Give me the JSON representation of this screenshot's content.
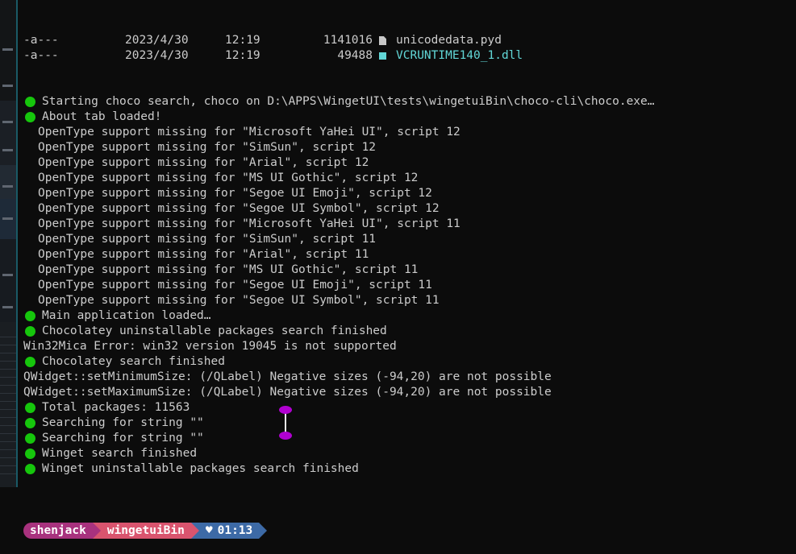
{
  "listing": [
    {
      "perm": "-a---",
      "date": "2023/4/30",
      "time": "12:19",
      "size": "1141016",
      "icon": "file-icon",
      "name": "unicodedata.pyd",
      "highlight": false
    },
    {
      "perm": "-a---",
      "date": "2023/4/30",
      "time": "12:19",
      "size": "49488",
      "icon": "dll-file-icon",
      "name": "VCRUNTIME140_1.dll",
      "highlight": true
    }
  ],
  "log": [
    {
      "dot": true,
      "text": "Starting choco search, choco on D:\\APPS\\WingetUI\\tests\\wingetuiBin\\choco-cli\\choco.exe…"
    },
    {
      "dot": true,
      "text": "About tab loaded!"
    },
    {
      "dot": false,
      "indent": true,
      "text": "OpenType support missing for \"Microsoft YaHei UI\", script 12"
    },
    {
      "dot": false,
      "indent": true,
      "text": "OpenType support missing for \"SimSun\", script 12"
    },
    {
      "dot": false,
      "indent": true,
      "text": "OpenType support missing for \"Arial\", script 12"
    },
    {
      "dot": false,
      "indent": true,
      "text": "OpenType support missing for \"MS UI Gothic\", script 12"
    },
    {
      "dot": false,
      "indent": true,
      "text": "OpenType support missing for \"Segoe UI Emoji\", script 12"
    },
    {
      "dot": false,
      "indent": true,
      "text": "OpenType support missing for \"Segoe UI Symbol\", script 12"
    },
    {
      "dot": false,
      "indent": true,
      "text": "OpenType support missing for \"Microsoft YaHei UI\", script 11"
    },
    {
      "dot": false,
      "indent": true,
      "text": "OpenType support missing for \"SimSun\", script 11"
    },
    {
      "dot": false,
      "indent": true,
      "text": "OpenType support missing for \"Arial\", script 11"
    },
    {
      "dot": false,
      "indent": true,
      "text": "OpenType support missing for \"MS UI Gothic\", script 11"
    },
    {
      "dot": false,
      "indent": true,
      "text": "OpenType support missing for \"Segoe UI Emoji\", script 11"
    },
    {
      "dot": false,
      "indent": true,
      "text": "OpenType support missing for \"Segoe UI Symbol\", script 11"
    },
    {
      "dot": true,
      "text": "Main application loaded…"
    },
    {
      "dot": true,
      "text": "Chocolatey uninstallable packages search finished"
    },
    {
      "dot": false,
      "text": "Win32Mica Error: win32 version 19045 is not supported"
    },
    {
      "dot": true,
      "text": "Chocolatey search finished"
    },
    {
      "dot": false,
      "text": "QWidget::setMinimumSize: (/QLabel) Negative sizes (-94,20) are not possible"
    },
    {
      "dot": false,
      "text": "QWidget::setMaximumSize: (/QLabel) Negative sizes (-94,20) are not possible"
    },
    {
      "dot": true,
      "text": "Total packages: 11563"
    },
    {
      "dot": true,
      "text": "Searching for string \"\""
    },
    {
      "dot": true,
      "text": "Searching for string \"\""
    },
    {
      "dot": true,
      "text": "Winget search finished"
    },
    {
      "dot": true,
      "text": "Winget uninstallable packages search finished"
    }
  ],
  "prompt": {
    "user": "shenjack",
    "directory": "wingetuiBin",
    "heart": "♥",
    "time": "01:13"
  },
  "colors": {
    "status_dot": "#16c60c",
    "highlight_text": "#61d6d6",
    "prompt_user_bg": "#a8327e",
    "prompt_dir_bg": "#d9546e",
    "prompt_time_bg": "#3d6aa6",
    "cursor_cap": "#b000d0"
  }
}
